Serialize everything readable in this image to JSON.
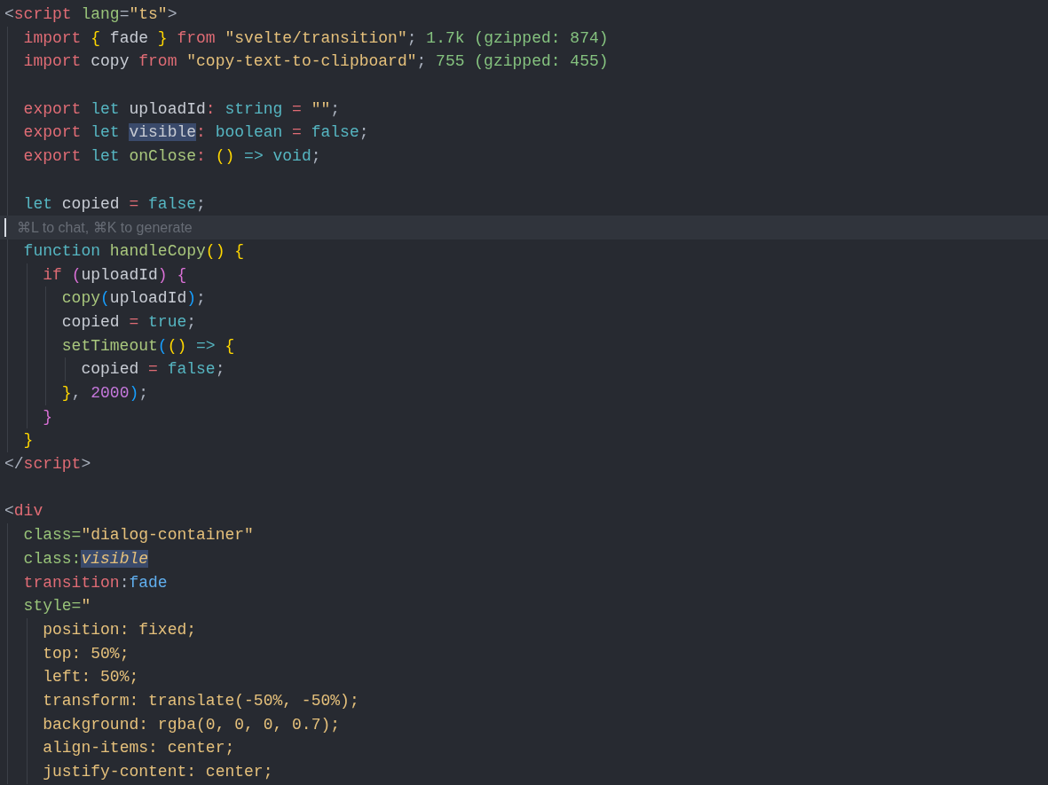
{
  "editor": {
    "lines": [
      {
        "kind": "code",
        "tokens": [
          {
            "kind": "punct",
            "text": "<"
          },
          {
            "kind": "tag",
            "text": "script"
          },
          {
            "kind": "attr",
            "text": " lang"
          },
          {
            "kind": "punct",
            "text": "="
          },
          {
            "kind": "str",
            "text": "\"ts\""
          },
          {
            "kind": "punct",
            "text": ">"
          }
        ]
      },
      {
        "kind": "code",
        "tokens": [
          {
            "kind": "kw",
            "text": "  import"
          },
          {
            "kind": "brace-y",
            "text": " {"
          },
          {
            "kind": "ident",
            "text": " fade"
          },
          {
            "kind": "brace-y",
            "text": " }"
          },
          {
            "kind": "kw",
            "text": " from"
          },
          {
            "kind": "str",
            "text": " \"svelte/transition\""
          },
          {
            "kind": "punct",
            "text": ";"
          }
        ],
        "annotation": "1.7k (gzipped: 874)"
      },
      {
        "kind": "code",
        "tokens": [
          {
            "kind": "kw",
            "text": "  import"
          },
          {
            "kind": "ident",
            "text": " copy"
          },
          {
            "kind": "kw",
            "text": " from"
          },
          {
            "kind": "str",
            "text": " \"copy-text-to-clipboard\""
          },
          {
            "kind": "punct",
            "text": ";"
          }
        ],
        "annotation": "755 (gzipped: 455)"
      },
      {
        "kind": "blank"
      },
      {
        "kind": "code",
        "tokens": [
          {
            "kind": "kw",
            "text": "  export"
          },
          {
            "kind": "decl",
            "text": " let"
          },
          {
            "kind": "ident",
            "text": " uploadId"
          },
          {
            "kind": "op",
            "text": ":"
          },
          {
            "kind": "decl",
            "text": " string"
          },
          {
            "kind": "op",
            "text": " ="
          },
          {
            "kind": "str",
            "text": " \"\""
          },
          {
            "kind": "punct",
            "text": ";"
          }
        ]
      },
      {
        "kind": "code",
        "tokens": [
          {
            "kind": "kw",
            "text": "  export"
          },
          {
            "kind": "decl",
            "text": " let "
          },
          {
            "kind": "match",
            "text": "visible"
          },
          {
            "kind": "op",
            "text": ":"
          },
          {
            "kind": "decl",
            "text": " boolean"
          },
          {
            "kind": "op",
            "text": " ="
          },
          {
            "kind": "decl",
            "text": " false"
          },
          {
            "kind": "punct",
            "text": ";"
          }
        ]
      },
      {
        "kind": "code",
        "tokens": [
          {
            "kind": "kw",
            "text": "  export"
          },
          {
            "kind": "decl",
            "text": " let"
          },
          {
            "kind": "fn",
            "text": " onClose"
          },
          {
            "kind": "op",
            "text": ":"
          },
          {
            "kind": "brace-y",
            "text": " ()"
          },
          {
            "kind": "decl",
            "text": " =>"
          },
          {
            "kind": "decl",
            "text": " void"
          },
          {
            "kind": "punct",
            "text": ";"
          }
        ]
      },
      {
        "kind": "blank"
      },
      {
        "kind": "code",
        "tokens": [
          {
            "kind": "decl",
            "text": "  let"
          },
          {
            "kind": "ident",
            "text": " copied"
          },
          {
            "kind": "op",
            "text": " ="
          },
          {
            "kind": "decl",
            "text": " false"
          },
          {
            "kind": "punct",
            "text": ";"
          }
        ]
      },
      {
        "kind": "hint",
        "text": "⌘L to chat, ⌘K to generate"
      },
      {
        "kind": "code",
        "tokens": [
          {
            "kind": "decl",
            "text": "  function"
          },
          {
            "kind": "fn",
            "text": " handleCopy"
          },
          {
            "kind": "brace-y",
            "text": "()"
          },
          {
            "kind": "brace-y",
            "text": " {"
          }
        ]
      },
      {
        "kind": "code",
        "tokens": [
          {
            "kind": "kw",
            "text": "    if"
          },
          {
            "kind": "brace-p",
            "text": " ("
          },
          {
            "kind": "ident",
            "text": "uploadId"
          },
          {
            "kind": "brace-p",
            "text": ")"
          },
          {
            "kind": "brace-p",
            "text": " {"
          }
        ]
      },
      {
        "kind": "code",
        "tokens": [
          {
            "kind": "fn",
            "text": "      copy"
          },
          {
            "kind": "brace-b",
            "text": "("
          },
          {
            "kind": "ident",
            "text": "uploadId"
          },
          {
            "kind": "brace-b",
            "text": ")"
          },
          {
            "kind": "punct",
            "text": ";"
          }
        ]
      },
      {
        "kind": "code",
        "tokens": [
          {
            "kind": "ident",
            "text": "      copied"
          },
          {
            "kind": "op",
            "text": " ="
          },
          {
            "kind": "decl",
            "text": " true"
          },
          {
            "kind": "punct",
            "text": ";"
          }
        ]
      },
      {
        "kind": "code",
        "tokens": [
          {
            "kind": "fn",
            "text": "      setTimeout"
          },
          {
            "kind": "brace-b",
            "text": "("
          },
          {
            "kind": "brace-y",
            "text": "()"
          },
          {
            "kind": "decl",
            "text": " =>"
          },
          {
            "kind": "brace-y",
            "text": " {"
          }
        ]
      },
      {
        "kind": "code",
        "tokens": [
          {
            "kind": "ident",
            "text": "        copied"
          },
          {
            "kind": "op",
            "text": " ="
          },
          {
            "kind": "decl",
            "text": " false"
          },
          {
            "kind": "punct",
            "text": ";"
          }
        ]
      },
      {
        "kind": "code",
        "tokens": [
          {
            "kind": "brace-y",
            "text": "      }"
          },
          {
            "kind": "punct",
            "text": ","
          },
          {
            "kind": "num",
            "text": " 2000"
          },
          {
            "kind": "brace-b",
            "text": ")"
          },
          {
            "kind": "punct",
            "text": ";"
          }
        ]
      },
      {
        "kind": "code",
        "tokens": [
          {
            "kind": "brace-p",
            "text": "    }"
          }
        ]
      },
      {
        "kind": "code",
        "tokens": [
          {
            "kind": "brace-y",
            "text": "  }"
          }
        ]
      },
      {
        "kind": "code",
        "tokens": [
          {
            "kind": "punct",
            "text": "</"
          },
          {
            "kind": "tag",
            "text": "script"
          },
          {
            "kind": "punct",
            "text": ">"
          }
        ]
      },
      {
        "kind": "blank"
      },
      {
        "kind": "code",
        "tokens": [
          {
            "kind": "punct",
            "text": "<"
          },
          {
            "kind": "tag",
            "text": "div"
          }
        ]
      },
      {
        "kind": "code",
        "tokens": [
          {
            "kind": "attr",
            "text": "  class="
          },
          {
            "kind": "str",
            "text": "\"dialog-container\""
          }
        ]
      },
      {
        "kind": "code",
        "tokens": [
          {
            "kind": "attr",
            "text": "  class:"
          },
          {
            "kind": "match-italic",
            "text": "visible"
          }
        ]
      },
      {
        "kind": "code",
        "tokens": [
          {
            "kind": "attr-alt",
            "text": "  transition"
          },
          {
            "kind": "punct",
            "text": ":"
          },
          {
            "kind": "directive",
            "text": "fade"
          }
        ]
      },
      {
        "kind": "code",
        "tokens": [
          {
            "kind": "attr",
            "text": "  style="
          },
          {
            "kind": "str",
            "text": "\""
          }
        ]
      },
      {
        "kind": "code",
        "tokens": [
          {
            "kind": "css",
            "text": "    position: fixed;"
          }
        ]
      },
      {
        "kind": "code",
        "tokens": [
          {
            "kind": "css",
            "text": "    top: 50%;"
          }
        ]
      },
      {
        "kind": "code",
        "tokens": [
          {
            "kind": "css",
            "text": "    left: 50%;"
          }
        ]
      },
      {
        "kind": "code",
        "tokens": [
          {
            "kind": "css",
            "text": "    transform: translate(-50%, -50%);"
          }
        ]
      },
      {
        "kind": "code",
        "tokens": [
          {
            "kind": "css",
            "text": "    background: rgba(0, 0, 0, 0.7);"
          }
        ]
      },
      {
        "kind": "code",
        "tokens": [
          {
            "kind": "css",
            "text": "    align-items: center;"
          }
        ]
      },
      {
        "kind": "code",
        "tokens": [
          {
            "kind": "css",
            "text": "    justify-content: center;"
          }
        ]
      }
    ]
  }
}
